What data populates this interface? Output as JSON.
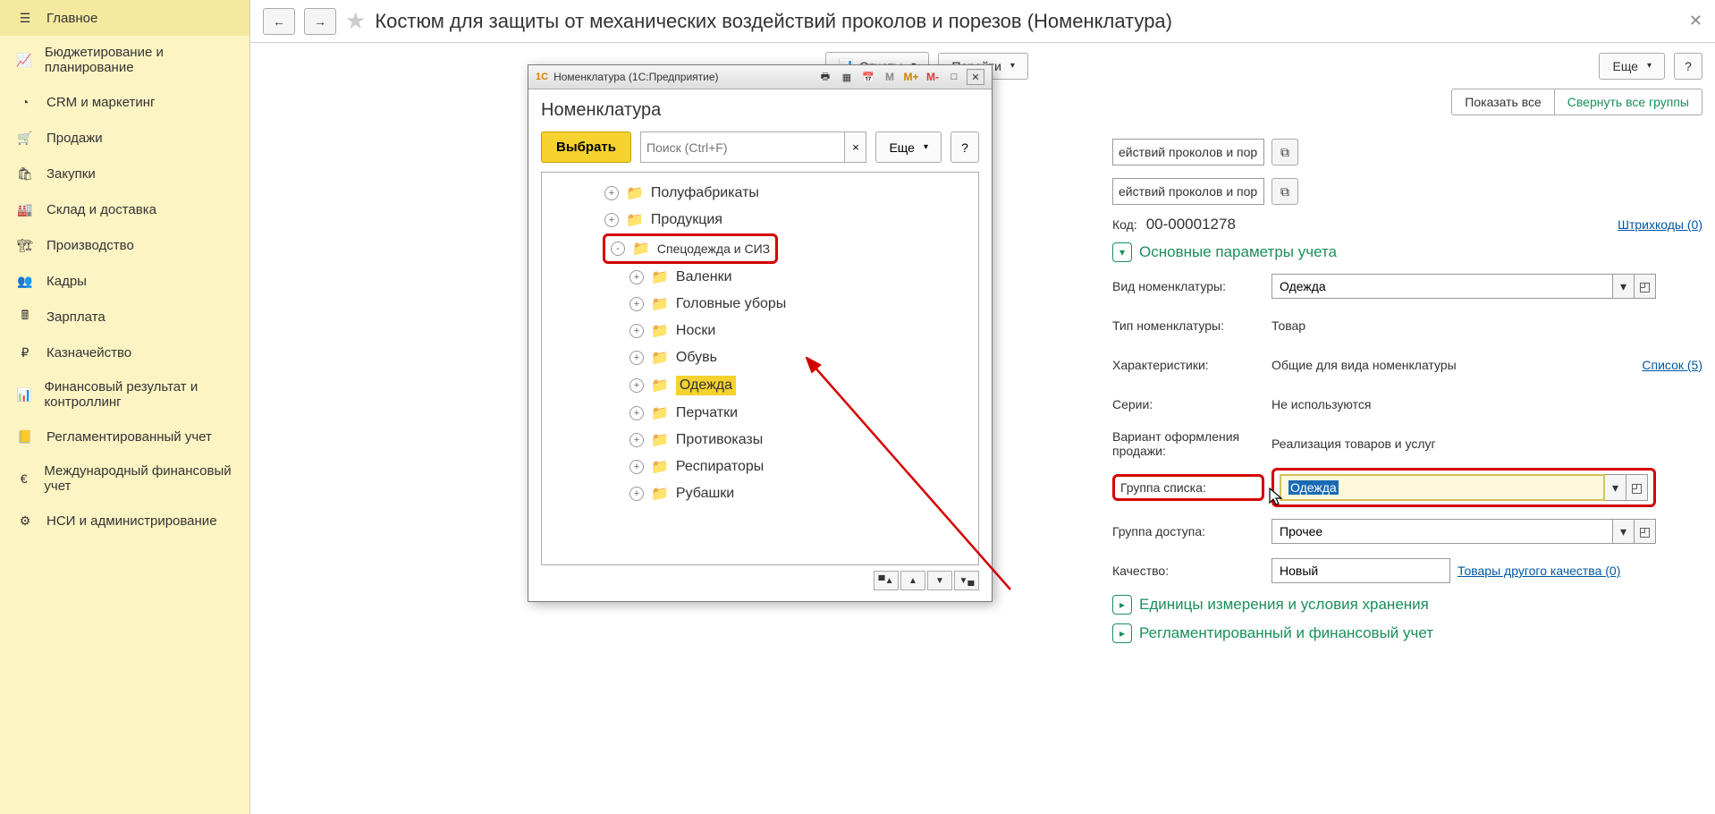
{
  "sidebar": {
    "items": [
      {
        "label": "Главное",
        "icon": "menu"
      },
      {
        "label": "Бюджетирование и планирование",
        "icon": "chart"
      },
      {
        "label": "CRM и маркетинг",
        "icon": "pie"
      },
      {
        "label": "Продажи",
        "icon": "cart"
      },
      {
        "label": "Закупки",
        "icon": "basket"
      },
      {
        "label": "Склад и доставка",
        "icon": "warehouse"
      },
      {
        "label": "Производство",
        "icon": "factory"
      },
      {
        "label": "Кадры",
        "icon": "people"
      },
      {
        "label": "Зарплата",
        "icon": "calc"
      },
      {
        "label": "Казначейство",
        "icon": "ruble"
      },
      {
        "label": "Финансовый результат и контроллинг",
        "icon": "bars"
      },
      {
        "label": "Регламентированный учет",
        "icon": "ledger"
      },
      {
        "label": "Международный финансовый учет",
        "icon": "euro"
      },
      {
        "label": "НСИ и администрирование",
        "icon": "gear"
      }
    ]
  },
  "header": {
    "title": "Костюм для защиты от механических воздействий проколов и порезов (Номенклатура)"
  },
  "toolbar": {
    "reports": "Отчеты",
    "go": "Перейти",
    "more": "Еще",
    "help": "?"
  },
  "segments": {
    "show_all": "Показать все",
    "collapse": "Свернуть все группы"
  },
  "form": {
    "clip1": "ействий проколов и пор",
    "clip2": "ействий проколов и пор",
    "code_label": "Код:",
    "code_value": "00-00001278",
    "barcodes": "Штрихкоды (0)",
    "section_main": "Основные параметры учета",
    "type_label": "Вид номенклатуры:",
    "type_value": "Одежда",
    "nomtype_label": "Тип номенклатуры:",
    "nomtype_value": "Товар",
    "char_label": "Характеристики:",
    "char_value": "Общие для вида номенклатуры",
    "char_link": "Список (5)",
    "series_label": "Серии:",
    "series_value": "Не используются",
    "saleform_label": "Вариант оформления продажи:",
    "saleform_value": "Реализация товаров и услуг",
    "group_label": "Группа списка:",
    "group_value": "Одежда",
    "access_label": "Группа доступа:",
    "access_value": "Прочее",
    "quality_label": "Качество:",
    "quality_value": "Новый",
    "quality_link": "Товары другого качества (0)",
    "section_units": "Единицы измерения и условия хранения",
    "section_fin": "Регламентированный и финансовый учет"
  },
  "popup": {
    "window_title": "Номенклатура  (1С:Предприятие)",
    "heading": "Номенклатура",
    "select_btn": "Выбрать",
    "search_placeholder": "Поиск (Ctrl+F)",
    "more": "Еще",
    "help": "?",
    "tree": [
      {
        "label": "Полуфабрикаты",
        "level": 1,
        "expand": "+"
      },
      {
        "label": "Продукция",
        "level": 1,
        "expand": "+"
      },
      {
        "label": "Спецодежда и СИЗ",
        "level": 1,
        "expand": "-",
        "highlight": true
      },
      {
        "label": "Валенки",
        "level": 2,
        "expand": "+"
      },
      {
        "label": "Головные уборы",
        "level": 2,
        "expand": "+"
      },
      {
        "label": "Носки",
        "level": 2,
        "expand": "+"
      },
      {
        "label": "Обувь",
        "level": 2,
        "expand": "+"
      },
      {
        "label": "Одежда",
        "level": 2,
        "expand": "+",
        "selected": true
      },
      {
        "label": "Перчатки",
        "level": 2,
        "expand": "+"
      },
      {
        "label": "Противоказы",
        "level": 2,
        "expand": "+"
      },
      {
        "label": "Респираторы",
        "level": 2,
        "expand": "+"
      },
      {
        "label": "Рубашки",
        "level": 2,
        "expand": "+"
      }
    ]
  }
}
